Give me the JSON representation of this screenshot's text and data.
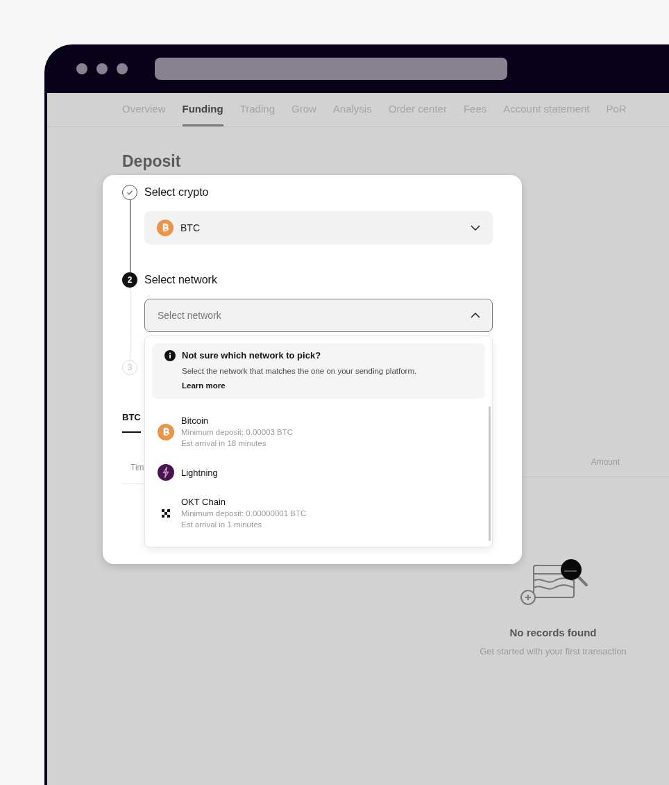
{
  "nav_tabs": [
    {
      "label": "Overview",
      "selected": false
    },
    {
      "label": "Funding",
      "selected": true
    },
    {
      "label": "Trading",
      "selected": false
    },
    {
      "label": "Grow",
      "selected": false
    },
    {
      "label": "Analysis",
      "selected": false
    },
    {
      "label": "Order center",
      "selected": false
    },
    {
      "label": "Fees",
      "selected": false
    },
    {
      "label": "Account statement",
      "selected": false
    },
    {
      "label": "PoR",
      "selected": false
    }
  ],
  "page_title": "Deposit",
  "steps": [
    {
      "label": "Select crypto",
      "kind": "done",
      "field": {
        "value": "BTC",
        "kind": "bitcoin",
        "expanded": false
      }
    },
    {
      "number": "2",
      "label": "Select network",
      "kind": "current",
      "field": {
        "placeholder": "Select network",
        "expanded": true
      }
    },
    {
      "number": "3",
      "kind": "upcoming"
    }
  ],
  "dropdown": {
    "notice": {
      "title": "Not sure which network to pick?",
      "text": "Select the network that matches the one on your sending platform.",
      "link": "Learn more"
    },
    "options": [
      {
        "kind": "bitcoin",
        "name": "Bitcoin",
        "min_deposit": "Minimum deposit: 0.00003 BTC",
        "arrival": "Est arrival in 18 minutes"
      },
      {
        "kind": "lightning",
        "name": "Lightning"
      },
      {
        "kind": "okt",
        "name": "OKT Chain",
        "min_deposit": "Minimum deposit: 0.00000001 BTC",
        "arrival": "Est arrival in 1 minutes"
      }
    ]
  },
  "history_tabs": [
    {
      "label": "BTC",
      "selected": true
    }
  ],
  "table": {
    "columns": [
      "Tim",
      "Amount"
    ]
  },
  "empty_state": {
    "title": "No records found",
    "text": "Get started with your first transaction"
  }
}
